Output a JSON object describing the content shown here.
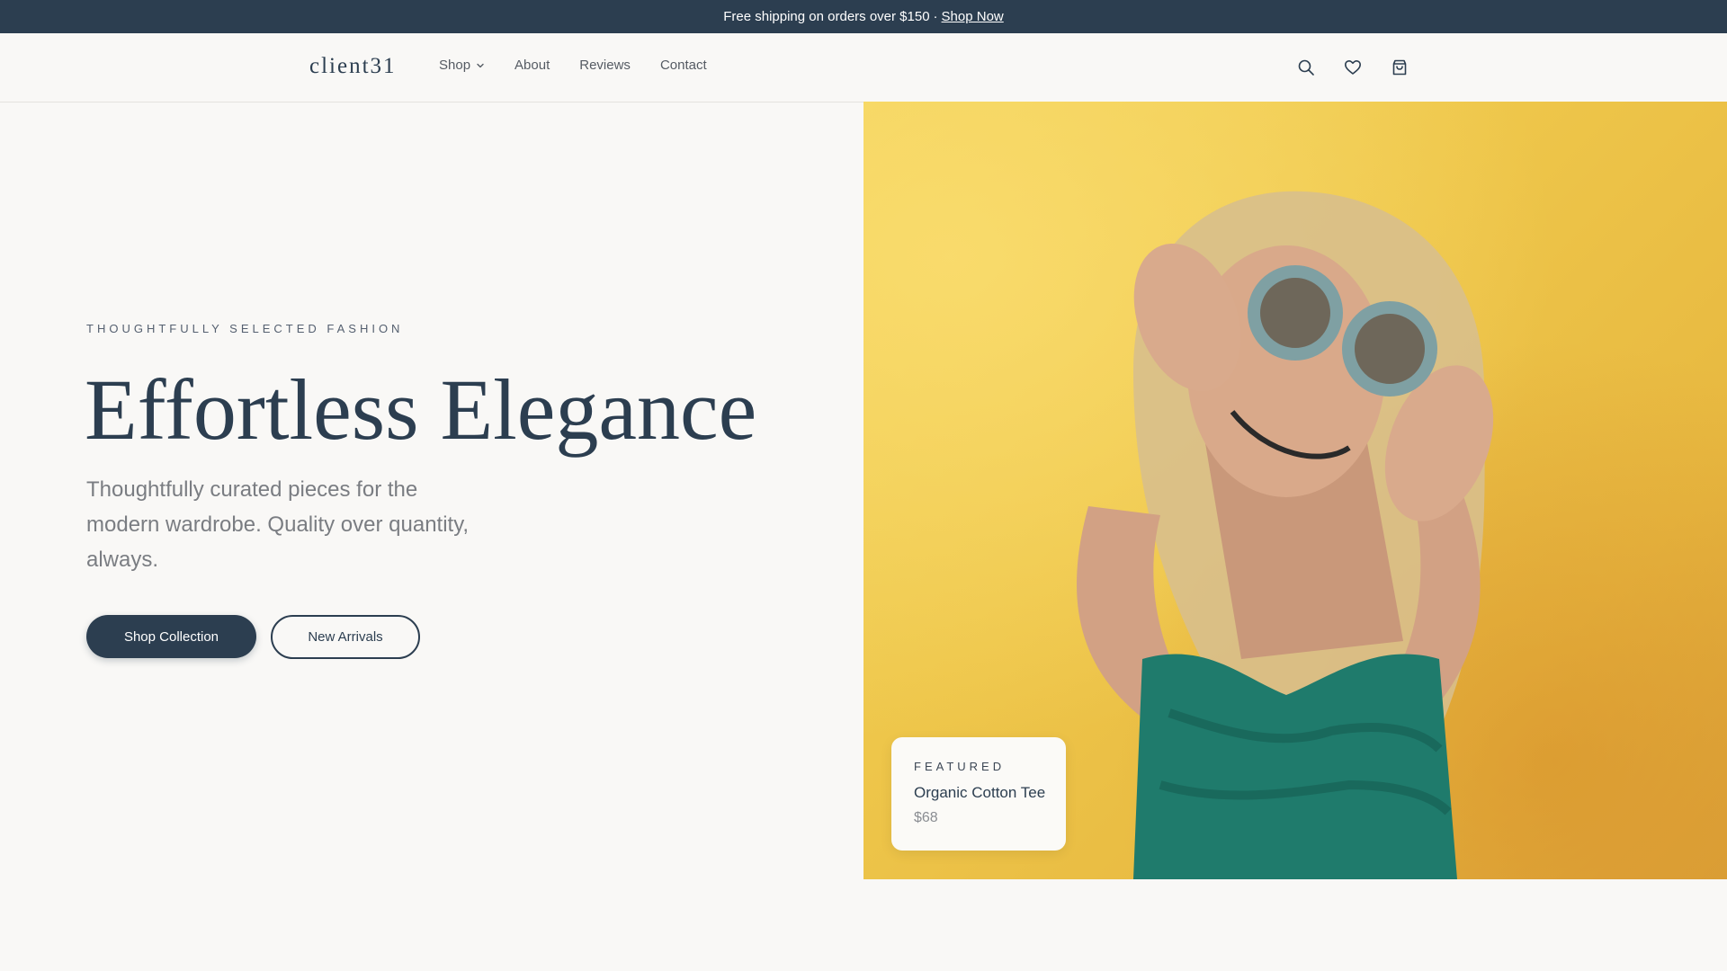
{
  "announcement": {
    "text": "Free shipping on orders over $150",
    "separator": "·",
    "link": "Shop Now"
  },
  "header": {
    "logo": "client31",
    "nav": [
      {
        "label": "Shop",
        "has_dropdown": true
      },
      {
        "label": "About"
      },
      {
        "label": "Reviews"
      },
      {
        "label": "Contact"
      }
    ],
    "icons": [
      "search-icon",
      "heart-icon",
      "shopping-bag-icon"
    ]
  },
  "hero": {
    "eyebrow": "THOUGHTFULLY SELECTED FASHION",
    "headline": "Effortless Elegance",
    "subhead": "Thoughtfully curated pieces for the modern wardrobe. Quality over quantity, always.",
    "primary_button": "Shop Collection",
    "secondary_button": "New Arrivals"
  },
  "featured": {
    "label": "FEATURED",
    "name": "Organic Cotton Tee",
    "price": "$68"
  },
  "colors": {
    "primary": "#2c3e50",
    "background": "#f9f8f6",
    "image_background": "#eec64a"
  }
}
